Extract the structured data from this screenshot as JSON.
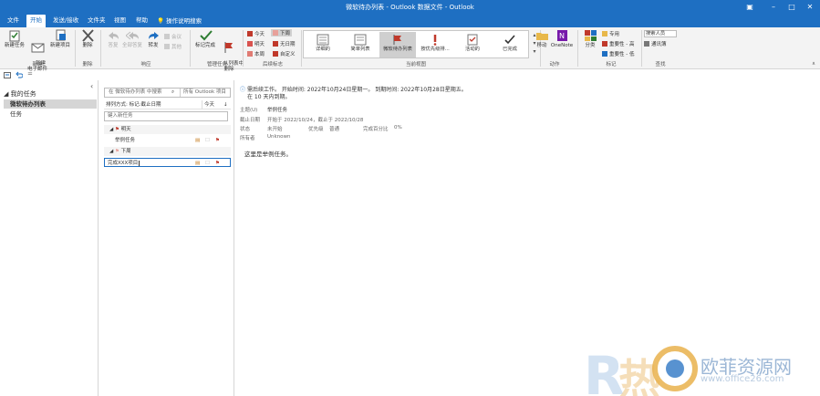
{
  "window": {
    "title": "微软待办列表 - Outlook 数据文件 - Outlook"
  },
  "tabs": [
    "文件",
    "开始",
    "发送/接收",
    "文件夹",
    "视图",
    "帮助"
  ],
  "active_tab": 1,
  "tell_me": "操作说明搜索",
  "ribbon": {
    "new": {
      "new_task": "新建任务",
      "new_email": "新建\n电子邮件",
      "new_items": "新建项目",
      "label": "新建"
    },
    "delete": {
      "delete": "删除",
      "label": "删除"
    },
    "respond": {
      "reply": "答复",
      "reply_all": "全部答复",
      "forward": "转发",
      "meeting": "会议",
      "more": "其他",
      "label": "响应"
    },
    "manage": {
      "mark_complete": "标记完成",
      "remove_from_list": "从列表中\n删除",
      "label": "管理任务"
    },
    "followup": {
      "today": "今天",
      "tomorrow": "明天",
      "this_week": "本周",
      "next_week": "下周",
      "no_date": "无日期",
      "custom": "自定义",
      "label": "后续标志"
    },
    "current_view": {
      "items": [
        "详细的",
        "简单列表",
        "微软待办列表",
        "按优先级排...",
        "活动的",
        "已完成"
      ],
      "selected": 2,
      "label": "当前视图"
    },
    "actions": {
      "move": "移动",
      "onenote": "OneNote",
      "label": "动作"
    },
    "tags": {
      "categorize": "分类",
      "private": "专用",
      "high_importance": "重要性 - 高",
      "low_importance": "重要性 - 低",
      "label": "标记"
    },
    "find": {
      "search_people": "搜索人员",
      "address_book": "通讯簿",
      "label": "查找"
    }
  },
  "nav": {
    "header": "我的任务",
    "items": [
      "微软待办列表",
      "任务"
    ],
    "selected": 0
  },
  "list": {
    "search_placeholder": "在 微软待办列表 中搜索",
    "search_scope": "所有 Outlook 项目",
    "sort_label": "排列方式: 标记:截止日期",
    "sort_value": "今天",
    "new_task_placeholder": "键入新任务",
    "groups": [
      {
        "name": "明天",
        "tasks": [
          "举例任务"
        ]
      },
      {
        "name": "下周",
        "tasks": [
          "完成XXX项目"
        ]
      }
    ]
  },
  "pane": {
    "info_line1": "需后续工作。  开始时间: 2022年10月24日星期一。  到期时间: 2022年10月28日星期五。",
    "info_line2": "在 10 天内到期。",
    "subject_label": "主题(U)",
    "subject": "举例任务",
    "due_label": "截止日期",
    "due": "开始于 2022/10/24，截止于 2022/10/28",
    "status_label": "状态",
    "status": "未开始",
    "priority_label": "优先级",
    "priority": "普通",
    "percent_label": "完成百分比",
    "percent": "0%",
    "owner_label": "所有者",
    "owner": "Unknown",
    "body": "这里是举例任务。"
  },
  "watermark": {
    "site": "www.office26.com",
    "brand": "欧菲资源网"
  },
  "colors": {
    "accent": "#1e6fc2",
    "flag": "#c0392b",
    "check": "#2e7d32"
  }
}
